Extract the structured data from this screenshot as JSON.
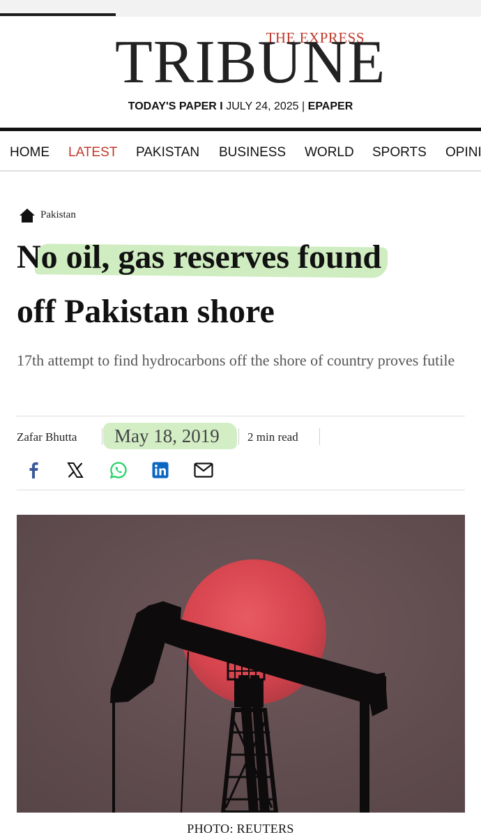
{
  "masthead": {
    "logo_small": "THE EXPRESS",
    "logo_main": "TRIBUNE",
    "todays_paper": "TODAY'S PAPER",
    "divider_one": "I",
    "date": "JULY 24, 2025",
    "divider_two": "|",
    "epaper": "EPAPER"
  },
  "nav": {
    "items": [
      {
        "label": "HOME"
      },
      {
        "label": "LATEST"
      },
      {
        "label": "PAKISTAN"
      },
      {
        "label": "BUSINESS"
      },
      {
        "label": "WORLD"
      },
      {
        "label": "SPORTS"
      },
      {
        "label": "OPINI"
      }
    ],
    "active": "LATEST"
  },
  "article": {
    "breadcrumb": "Pakistan",
    "headline_line1": "No oil, gas reserves found",
    "headline_line2": "off Pakistan shore",
    "subhead": "17th attempt to find hydrocarbons off the shore of country proves futile",
    "author": "Zafar Bhutta",
    "date": "May 18, 2019",
    "read_time": "2 min read",
    "share": [
      {
        "icon": "facebook-icon"
      },
      {
        "icon": "x-icon"
      },
      {
        "icon": "whatsapp-icon"
      },
      {
        "icon": "linkedin-icon"
      },
      {
        "icon": "email-icon"
      }
    ],
    "photo_caption": "PHOTO: REUTERS"
  },
  "colors": {
    "accent_red": "#c0392b",
    "highlight_green": "#a8de8c",
    "facebook": "#3b5998",
    "whatsapp": "#25d366",
    "linkedin": "#0a66c2",
    "photo_sky": "#5e4c4e",
    "sun": "#d9474f"
  }
}
